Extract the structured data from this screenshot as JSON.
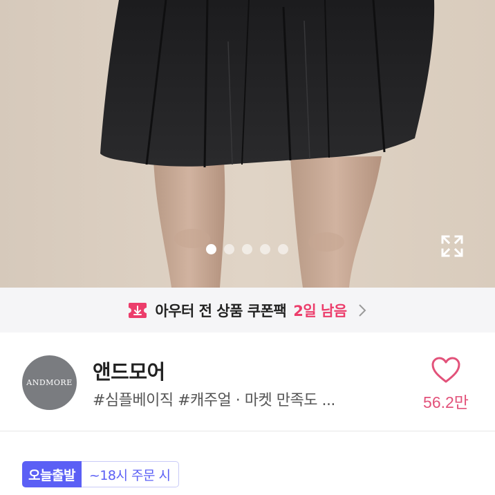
{
  "gallery": {
    "image_description": "product-photo",
    "dot_count": 5,
    "active_index": 0,
    "expand_icon": "expand-icon"
  },
  "coupon_banner": {
    "icon": "coupon-ticket-icon",
    "text": "아우터 전 상품 쿠폰팩",
    "highlight": "2일 남음",
    "chevron_icon": "chevron-right-icon",
    "accent_color": "#ec3d6b"
  },
  "store": {
    "logo_text": "ANDMORE",
    "name": "앤드모어",
    "tags": "#심플베이직 #캐주얼 · 마켓 만족도 ...",
    "like_icon": "heart-icon",
    "like_count": "56.2만",
    "like_color": "#e2527a"
  },
  "shipping": {
    "badge": "오늘출발",
    "condition": "~18시 주문 시",
    "badge_color": "#5b5ff5"
  }
}
